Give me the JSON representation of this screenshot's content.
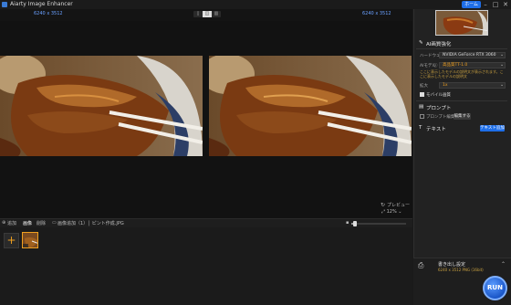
{
  "window": {
    "title": "Aiarty Image Enhancer",
    "home_button": "ホーム",
    "controls": [
      "–",
      "□",
      "✕"
    ]
  },
  "viewer": {
    "left_resolution": "6240 x 3512",
    "right_resolution": "6240 x 3512",
    "preview_label": "プレビュー",
    "zoom": "12%"
  },
  "bottom_bar": {
    "tab_all": "追加",
    "tab_image": "画像",
    "tab_video": "削除",
    "status_text": "画像追加（1）│ ピント作成.JPG"
  },
  "right_panel": {
    "section_ai": "AI画質強化",
    "hardware_label": "ハードウェア",
    "hardware_value": "NVIDIA GeForce RTX 3060",
    "model_label": "AIモデル",
    "model_value": "高品質TT-1.0",
    "note_text": "ここに表示したモデルの説明文が表示されます。ここに表示したモデルの説明文",
    "scale_label": "拡大",
    "scale_value": "1x",
    "checkbox_label": "モバイル画質",
    "section_prompt": "プロンプト",
    "prompt_checkbox_label": "プロンプト編集",
    "prompt_edit_button": "編集する",
    "section_text": "テキスト",
    "text_add_button": "テキスト追加",
    "export_title": "書き出し設定",
    "export_detail": "6240 x 3512  PNG  (16bit)",
    "run_button": "RUN"
  }
}
